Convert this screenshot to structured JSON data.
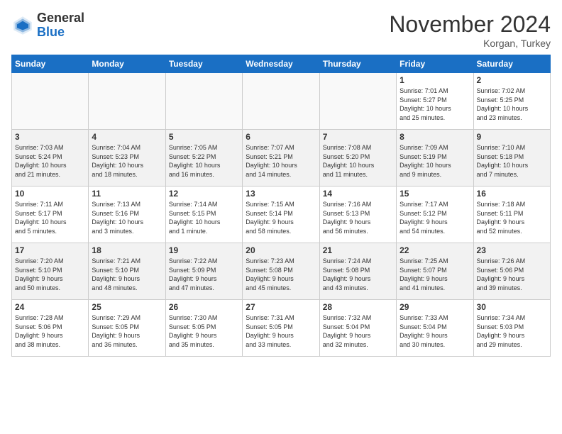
{
  "header": {
    "logo_general": "General",
    "logo_blue": "Blue",
    "month": "November 2024",
    "location": "Korgan, Turkey"
  },
  "weekdays": [
    "Sunday",
    "Monday",
    "Tuesday",
    "Wednesday",
    "Thursday",
    "Friday",
    "Saturday"
  ],
  "weeks": [
    [
      {
        "day": "",
        "info": ""
      },
      {
        "day": "",
        "info": ""
      },
      {
        "day": "",
        "info": ""
      },
      {
        "day": "",
        "info": ""
      },
      {
        "day": "",
        "info": ""
      },
      {
        "day": "1",
        "info": "Sunrise: 7:01 AM\nSunset: 5:27 PM\nDaylight: 10 hours\nand 25 minutes."
      },
      {
        "day": "2",
        "info": "Sunrise: 7:02 AM\nSunset: 5:25 PM\nDaylight: 10 hours\nand 23 minutes."
      }
    ],
    [
      {
        "day": "3",
        "info": "Sunrise: 7:03 AM\nSunset: 5:24 PM\nDaylight: 10 hours\nand 21 minutes."
      },
      {
        "day": "4",
        "info": "Sunrise: 7:04 AM\nSunset: 5:23 PM\nDaylight: 10 hours\nand 18 minutes."
      },
      {
        "day": "5",
        "info": "Sunrise: 7:05 AM\nSunset: 5:22 PM\nDaylight: 10 hours\nand 16 minutes."
      },
      {
        "day": "6",
        "info": "Sunrise: 7:07 AM\nSunset: 5:21 PM\nDaylight: 10 hours\nand 14 minutes."
      },
      {
        "day": "7",
        "info": "Sunrise: 7:08 AM\nSunset: 5:20 PM\nDaylight: 10 hours\nand 11 minutes."
      },
      {
        "day": "8",
        "info": "Sunrise: 7:09 AM\nSunset: 5:19 PM\nDaylight: 10 hours\nand 9 minutes."
      },
      {
        "day": "9",
        "info": "Sunrise: 7:10 AM\nSunset: 5:18 PM\nDaylight: 10 hours\nand 7 minutes."
      }
    ],
    [
      {
        "day": "10",
        "info": "Sunrise: 7:11 AM\nSunset: 5:17 PM\nDaylight: 10 hours\nand 5 minutes."
      },
      {
        "day": "11",
        "info": "Sunrise: 7:13 AM\nSunset: 5:16 PM\nDaylight: 10 hours\nand 3 minutes."
      },
      {
        "day": "12",
        "info": "Sunrise: 7:14 AM\nSunset: 5:15 PM\nDaylight: 10 hours\nand 1 minute."
      },
      {
        "day": "13",
        "info": "Sunrise: 7:15 AM\nSunset: 5:14 PM\nDaylight: 9 hours\nand 58 minutes."
      },
      {
        "day": "14",
        "info": "Sunrise: 7:16 AM\nSunset: 5:13 PM\nDaylight: 9 hours\nand 56 minutes."
      },
      {
        "day": "15",
        "info": "Sunrise: 7:17 AM\nSunset: 5:12 PM\nDaylight: 9 hours\nand 54 minutes."
      },
      {
        "day": "16",
        "info": "Sunrise: 7:18 AM\nSunset: 5:11 PM\nDaylight: 9 hours\nand 52 minutes."
      }
    ],
    [
      {
        "day": "17",
        "info": "Sunrise: 7:20 AM\nSunset: 5:10 PM\nDaylight: 9 hours\nand 50 minutes."
      },
      {
        "day": "18",
        "info": "Sunrise: 7:21 AM\nSunset: 5:10 PM\nDaylight: 9 hours\nand 48 minutes."
      },
      {
        "day": "19",
        "info": "Sunrise: 7:22 AM\nSunset: 5:09 PM\nDaylight: 9 hours\nand 47 minutes."
      },
      {
        "day": "20",
        "info": "Sunrise: 7:23 AM\nSunset: 5:08 PM\nDaylight: 9 hours\nand 45 minutes."
      },
      {
        "day": "21",
        "info": "Sunrise: 7:24 AM\nSunset: 5:08 PM\nDaylight: 9 hours\nand 43 minutes."
      },
      {
        "day": "22",
        "info": "Sunrise: 7:25 AM\nSunset: 5:07 PM\nDaylight: 9 hours\nand 41 minutes."
      },
      {
        "day": "23",
        "info": "Sunrise: 7:26 AM\nSunset: 5:06 PM\nDaylight: 9 hours\nand 39 minutes."
      }
    ],
    [
      {
        "day": "24",
        "info": "Sunrise: 7:28 AM\nSunset: 5:06 PM\nDaylight: 9 hours\nand 38 minutes."
      },
      {
        "day": "25",
        "info": "Sunrise: 7:29 AM\nSunset: 5:05 PM\nDaylight: 9 hours\nand 36 minutes."
      },
      {
        "day": "26",
        "info": "Sunrise: 7:30 AM\nSunset: 5:05 PM\nDaylight: 9 hours\nand 35 minutes."
      },
      {
        "day": "27",
        "info": "Sunrise: 7:31 AM\nSunset: 5:05 PM\nDaylight: 9 hours\nand 33 minutes."
      },
      {
        "day": "28",
        "info": "Sunrise: 7:32 AM\nSunset: 5:04 PM\nDaylight: 9 hours\nand 32 minutes."
      },
      {
        "day": "29",
        "info": "Sunrise: 7:33 AM\nSunset: 5:04 PM\nDaylight: 9 hours\nand 30 minutes."
      },
      {
        "day": "30",
        "info": "Sunrise: 7:34 AM\nSunset: 5:03 PM\nDaylight: 9 hours\nand 29 minutes."
      }
    ]
  ]
}
